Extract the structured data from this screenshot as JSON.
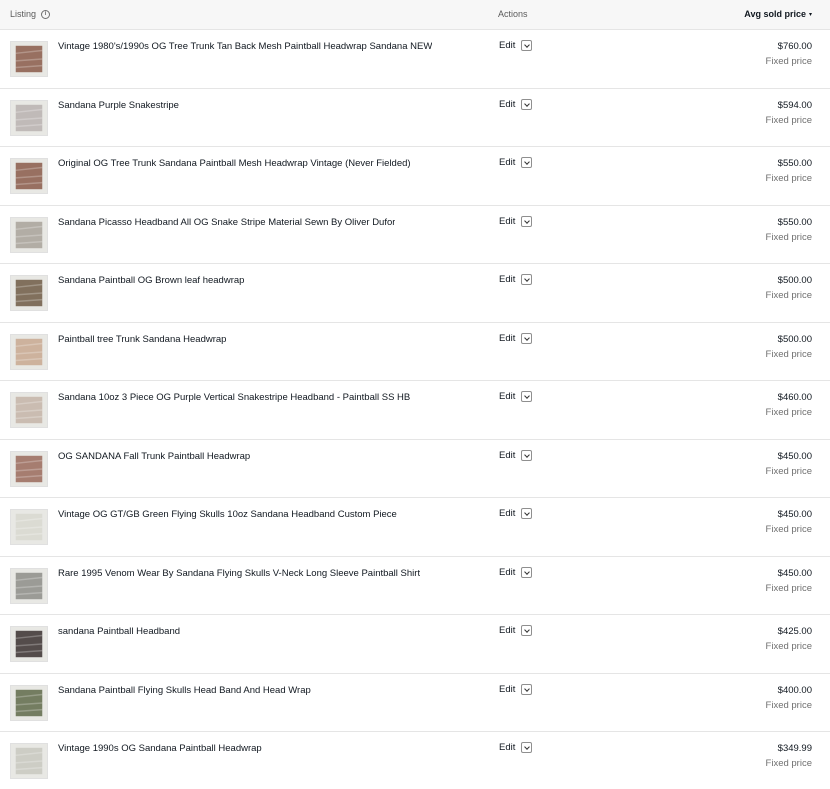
{
  "header": {
    "listing": "Listing",
    "actions": "Actions",
    "price": "Avg sold price"
  },
  "rows": [
    {
      "title": "Vintage 1980's/1990s OG Tree Trunk Tan Back Mesh Paintball Headwrap Sandana NEW",
      "edit": "Edit",
      "price": "$760.00",
      "type": "Fixed price",
      "thumb_color": "#8a5a4a"
    },
    {
      "title": "Sandana Purple Snakestripe",
      "edit": "Edit",
      "price": "$594.00",
      "type": "Fixed price",
      "thumb_color": "#b9b2b0"
    },
    {
      "title": "Original OG Tree Trunk Sandana Paintball Mesh Headwrap Vintage (Never Fielded)",
      "edit": "Edit",
      "price": "$550.00",
      "type": "Fixed price",
      "thumb_color": "#8a5a4a"
    },
    {
      "title": "Sandana Picasso Headband All OG Snake Stripe Material Sewn By Oliver Dufor",
      "edit": "Edit",
      "price": "$550.00",
      "type": "Fixed price",
      "thumb_color": "#a8a29a"
    },
    {
      "title": "Sandana Paintball OG Brown leaf headwrap",
      "edit": "Edit",
      "price": "$500.00",
      "type": "Fixed price",
      "thumb_color": "#6f5a45"
    },
    {
      "title": "Paintball tree Trunk Sandana Headwrap",
      "edit": "Edit",
      "price": "$500.00",
      "type": "Fixed price",
      "thumb_color": "#c8a890"
    },
    {
      "title": "Sandana 10oz 3 Piece OG Purple Vertical Snakestripe Headband - Paintball SS HB",
      "edit": "Edit",
      "price": "$460.00",
      "type": "Fixed price",
      "thumb_color": "#c4b4a8"
    },
    {
      "title": "OG SANDANA Fall Trunk Paintball Headwrap",
      "edit": "Edit",
      "price": "$450.00",
      "type": "Fixed price",
      "thumb_color": "#9a6a5c"
    },
    {
      "title": "Vintage OG GT/GB Green Flying Skulls 10oz Sandana Headband Custom Piece",
      "edit": "Edit",
      "price": "$450.00",
      "type": "Fixed price",
      "thumb_color": "#d8d8d0"
    },
    {
      "title": "Rare 1995 Venom Wear By Sandana Flying Skulls V-Neck Long Sleeve Paintball Shirt",
      "edit": "Edit",
      "price": "$450.00",
      "type": "Fixed price",
      "thumb_color": "#8d8d88"
    },
    {
      "title": "sandana Paintball Headband",
      "edit": "Edit",
      "price": "$425.00",
      "type": "Fixed price",
      "thumb_color": "#3a3030"
    },
    {
      "title": "Sandana Paintball Flying Skulls Head Band And Head Wrap",
      "edit": "Edit",
      "price": "$400.00",
      "type": "Fixed price",
      "thumb_color": "#5f6a4a"
    },
    {
      "title": "Vintage 1990s OG Sandana Paintball Headwrap",
      "edit": "Edit",
      "price": "$349.99",
      "type": "Fixed price",
      "thumb_color": "#c8c8c0"
    }
  ]
}
